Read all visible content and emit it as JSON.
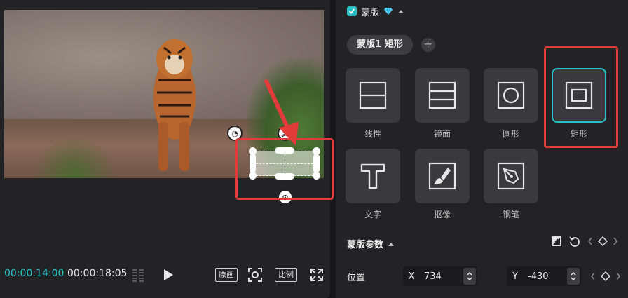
{
  "preview": {
    "time_current": "00:00:14:00",
    "time_total": "00:00:18:05",
    "original_label": "原画",
    "ratio_label": "比例",
    "icons": [
      "waveform-icon",
      "play-icon",
      "screenshot-icon",
      "fullscreen-icon"
    ]
  },
  "mask": {
    "title": "蒙版",
    "enabled": true,
    "tab_label": "蒙版1  矩形",
    "add_label": "+",
    "shapes": [
      {
        "label": "线性",
        "icon": "linear-mask-icon",
        "selected": false
      },
      {
        "label": "镜面",
        "icon": "mirror-mask-icon",
        "selected": false
      },
      {
        "label": "圆形",
        "icon": "circle-mask-icon",
        "selected": false
      },
      {
        "label": "矩形",
        "icon": "rectangle-mask-icon",
        "selected": true
      },
      {
        "label": "文字",
        "icon": "text-mask-icon",
        "selected": false
      },
      {
        "label": "抠像",
        "icon": "cutout-mask-icon",
        "selected": false
      },
      {
        "label": "钢笔",
        "icon": "pen-mask-icon",
        "selected": false
      }
    ],
    "params": {
      "title": "蒙版参数",
      "position_label": "位置",
      "x_axis": "X",
      "x_value": "734",
      "y_axis": "Y",
      "y_value": "-430"
    }
  },
  "colors": {
    "accent": "#27c0c7",
    "highlight": "#e33a3a",
    "panel_bg": "#232325",
    "tile_bg": "#3a3a3d"
  }
}
